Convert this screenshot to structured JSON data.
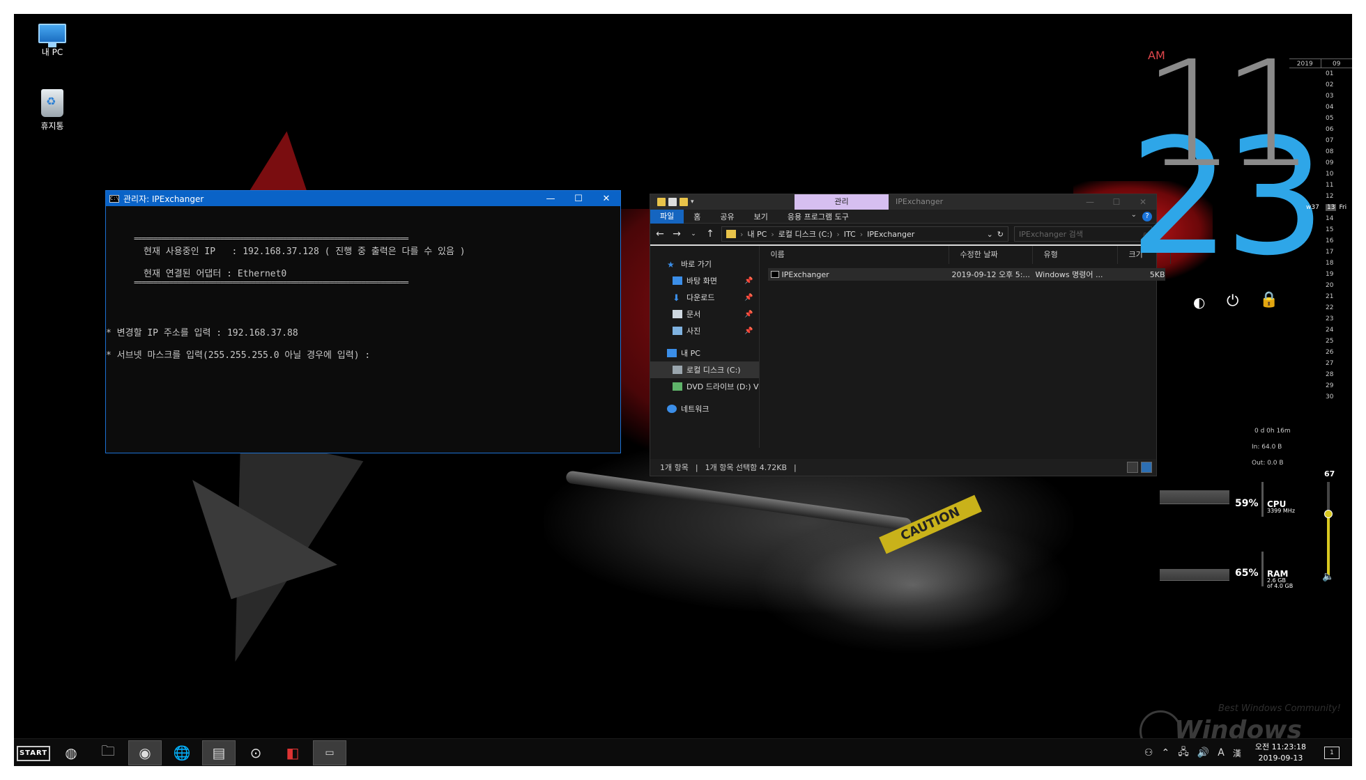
{
  "desktop": {
    "icons": [
      {
        "label": "내 PC",
        "icon": "this-pc-icon"
      },
      {
        "label": "휴지통",
        "icon": "recycle-bin-icon"
      }
    ],
    "wallpaper_text": "CAUTION"
  },
  "cmd": {
    "title": "관리자: IPExchanger",
    "divider": "======================================================================",
    "lines": [
      "현재 사용중인 IP   : 192.168.37.128 ( 진행 중 출력은 다를 수 있음 )",
      "현재 연결된 어댑터 : Ethernet0",
      "* 변경할 IP 주소를 입력 : 192.168.37.88",
      "* 서브넷 마스크를 입력(255.255.255.0 아닐 경우에 입력) :"
    ],
    "min_glyph": "—",
    "max_glyph": "☐",
    "close_glyph": "✕"
  },
  "explorer": {
    "title": "IPExchanger",
    "context_tab": "관리",
    "ribbon_tabs": [
      "파일",
      "홈",
      "공유",
      "보기",
      "응용 프로그램 도구"
    ],
    "address": [
      "내 PC",
      "로컬 디스크 (C:)",
      "ITC",
      "IPExchanger"
    ],
    "search_placeholder": "IPExchanger 검색",
    "nav": {
      "quick_access": "바로 가기",
      "pinned": [
        "바탕 화면",
        "다운로드",
        "문서",
        "사진"
      ],
      "this_pc": "내 PC",
      "local_disk": "로컬 디스크 (C:)",
      "dvd": "DVD 드라이브 (D:) V",
      "network": "네트워크"
    },
    "columns": [
      "이름",
      "수정한 날짜",
      "유형",
      "크기"
    ],
    "files": [
      {
        "name": "IPExchanger",
        "date": "2019-09-12 오후 5:...",
        "type": "Windows 명령어 ...",
        "size": "5KB"
      }
    ],
    "status": [
      "1개 항목",
      "1개 항목 선택함 4.72KB"
    ]
  },
  "clock": {
    "ampm": "AM",
    "hour": "11",
    "minute": "23"
  },
  "calendar": {
    "year": "2019",
    "month": "09",
    "week_label": "w37",
    "weekday_label": "Fri",
    "days": [
      "01",
      "02",
      "03",
      "04",
      "05",
      "06",
      "07",
      "08",
      "09",
      "10",
      "11",
      "12",
      "13",
      "14",
      "15",
      "16",
      "17",
      "18",
      "19",
      "20",
      "21",
      "22",
      "23",
      "24",
      "25",
      "26",
      "27",
      "28",
      "29",
      "30"
    ],
    "today": "13"
  },
  "system": {
    "uptime": "0 d 0h 16m",
    "net_in": "In: 64.0 B",
    "net_out": "Out: 0.0 B",
    "cpu": {
      "percent": "59%",
      "label": "CPU",
      "sub": "3399 MHz"
    },
    "ram": {
      "percent": "65%",
      "label": "RAM",
      "sub1": "2.6 GB",
      "sub2": "of 4.0 GB"
    },
    "volume": "67"
  },
  "watermark": {
    "caption": "Best Windows Community!",
    "brand": "Windows Forum"
  },
  "taskbar": {
    "start": "START",
    "apps": [
      "globe-icon",
      "folder-icon",
      "media-disc-icon",
      "web-browser-icon",
      "file-manager-icon",
      "media-player-icon",
      "flag-app-icon",
      "terminal-icon"
    ],
    "ime": "A",
    "ime2": "漢",
    "time": "오전 11:23:18",
    "date": "2019-09-13",
    "notifications": "1"
  },
  "colors": {
    "clock_hour": "#8a8a8a",
    "clock_minute": "#2ea6e8",
    "ampm": "#e0474c",
    "cmd_title": "#0a63c7",
    "ribbon_file": "#1565c0",
    "context_tab": "#d6bff0"
  }
}
